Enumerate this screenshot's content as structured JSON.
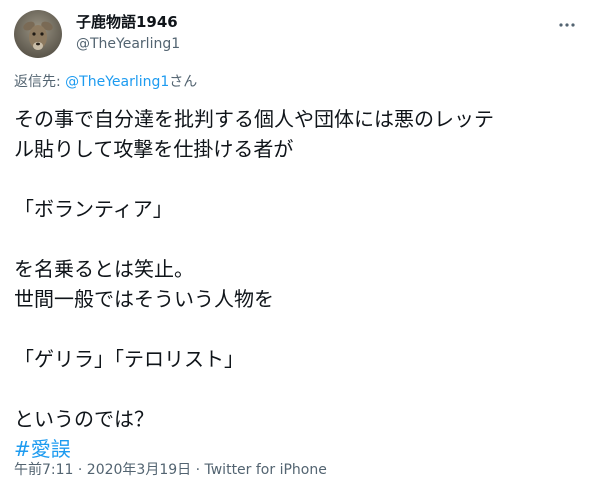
{
  "author": {
    "display_name": "子鹿物語1946",
    "handle": "@TheYearling1",
    "avatar_icon": "deer-photo-avatar"
  },
  "more_icon": "more-dots-icon",
  "reply": {
    "prefix": "返信先: ",
    "mention": "@TheYearling1",
    "suffix": "さん"
  },
  "body": {
    "lines": [
      "その事で自分達を批判する個人や団体には悪のレッテ",
      "ル貼りして攻撃を仕掛ける者が",
      "",
      "「ボランティア」",
      "",
      "を名乗るとは笑止。",
      "世間一般ではそういう人物を",
      "",
      "「ゲリラ」「テロリスト」",
      "",
      "というのでは？"
    ],
    "hashtag": "#愛誤"
  },
  "meta": {
    "timestamp": "午前7:11 · 2020年3月19日",
    "separator": " · ",
    "source": "Twitter for iPhone"
  },
  "colors": {
    "link": "#1d9bf0",
    "secondary_text": "#536471",
    "primary_text": "#0f1419"
  }
}
